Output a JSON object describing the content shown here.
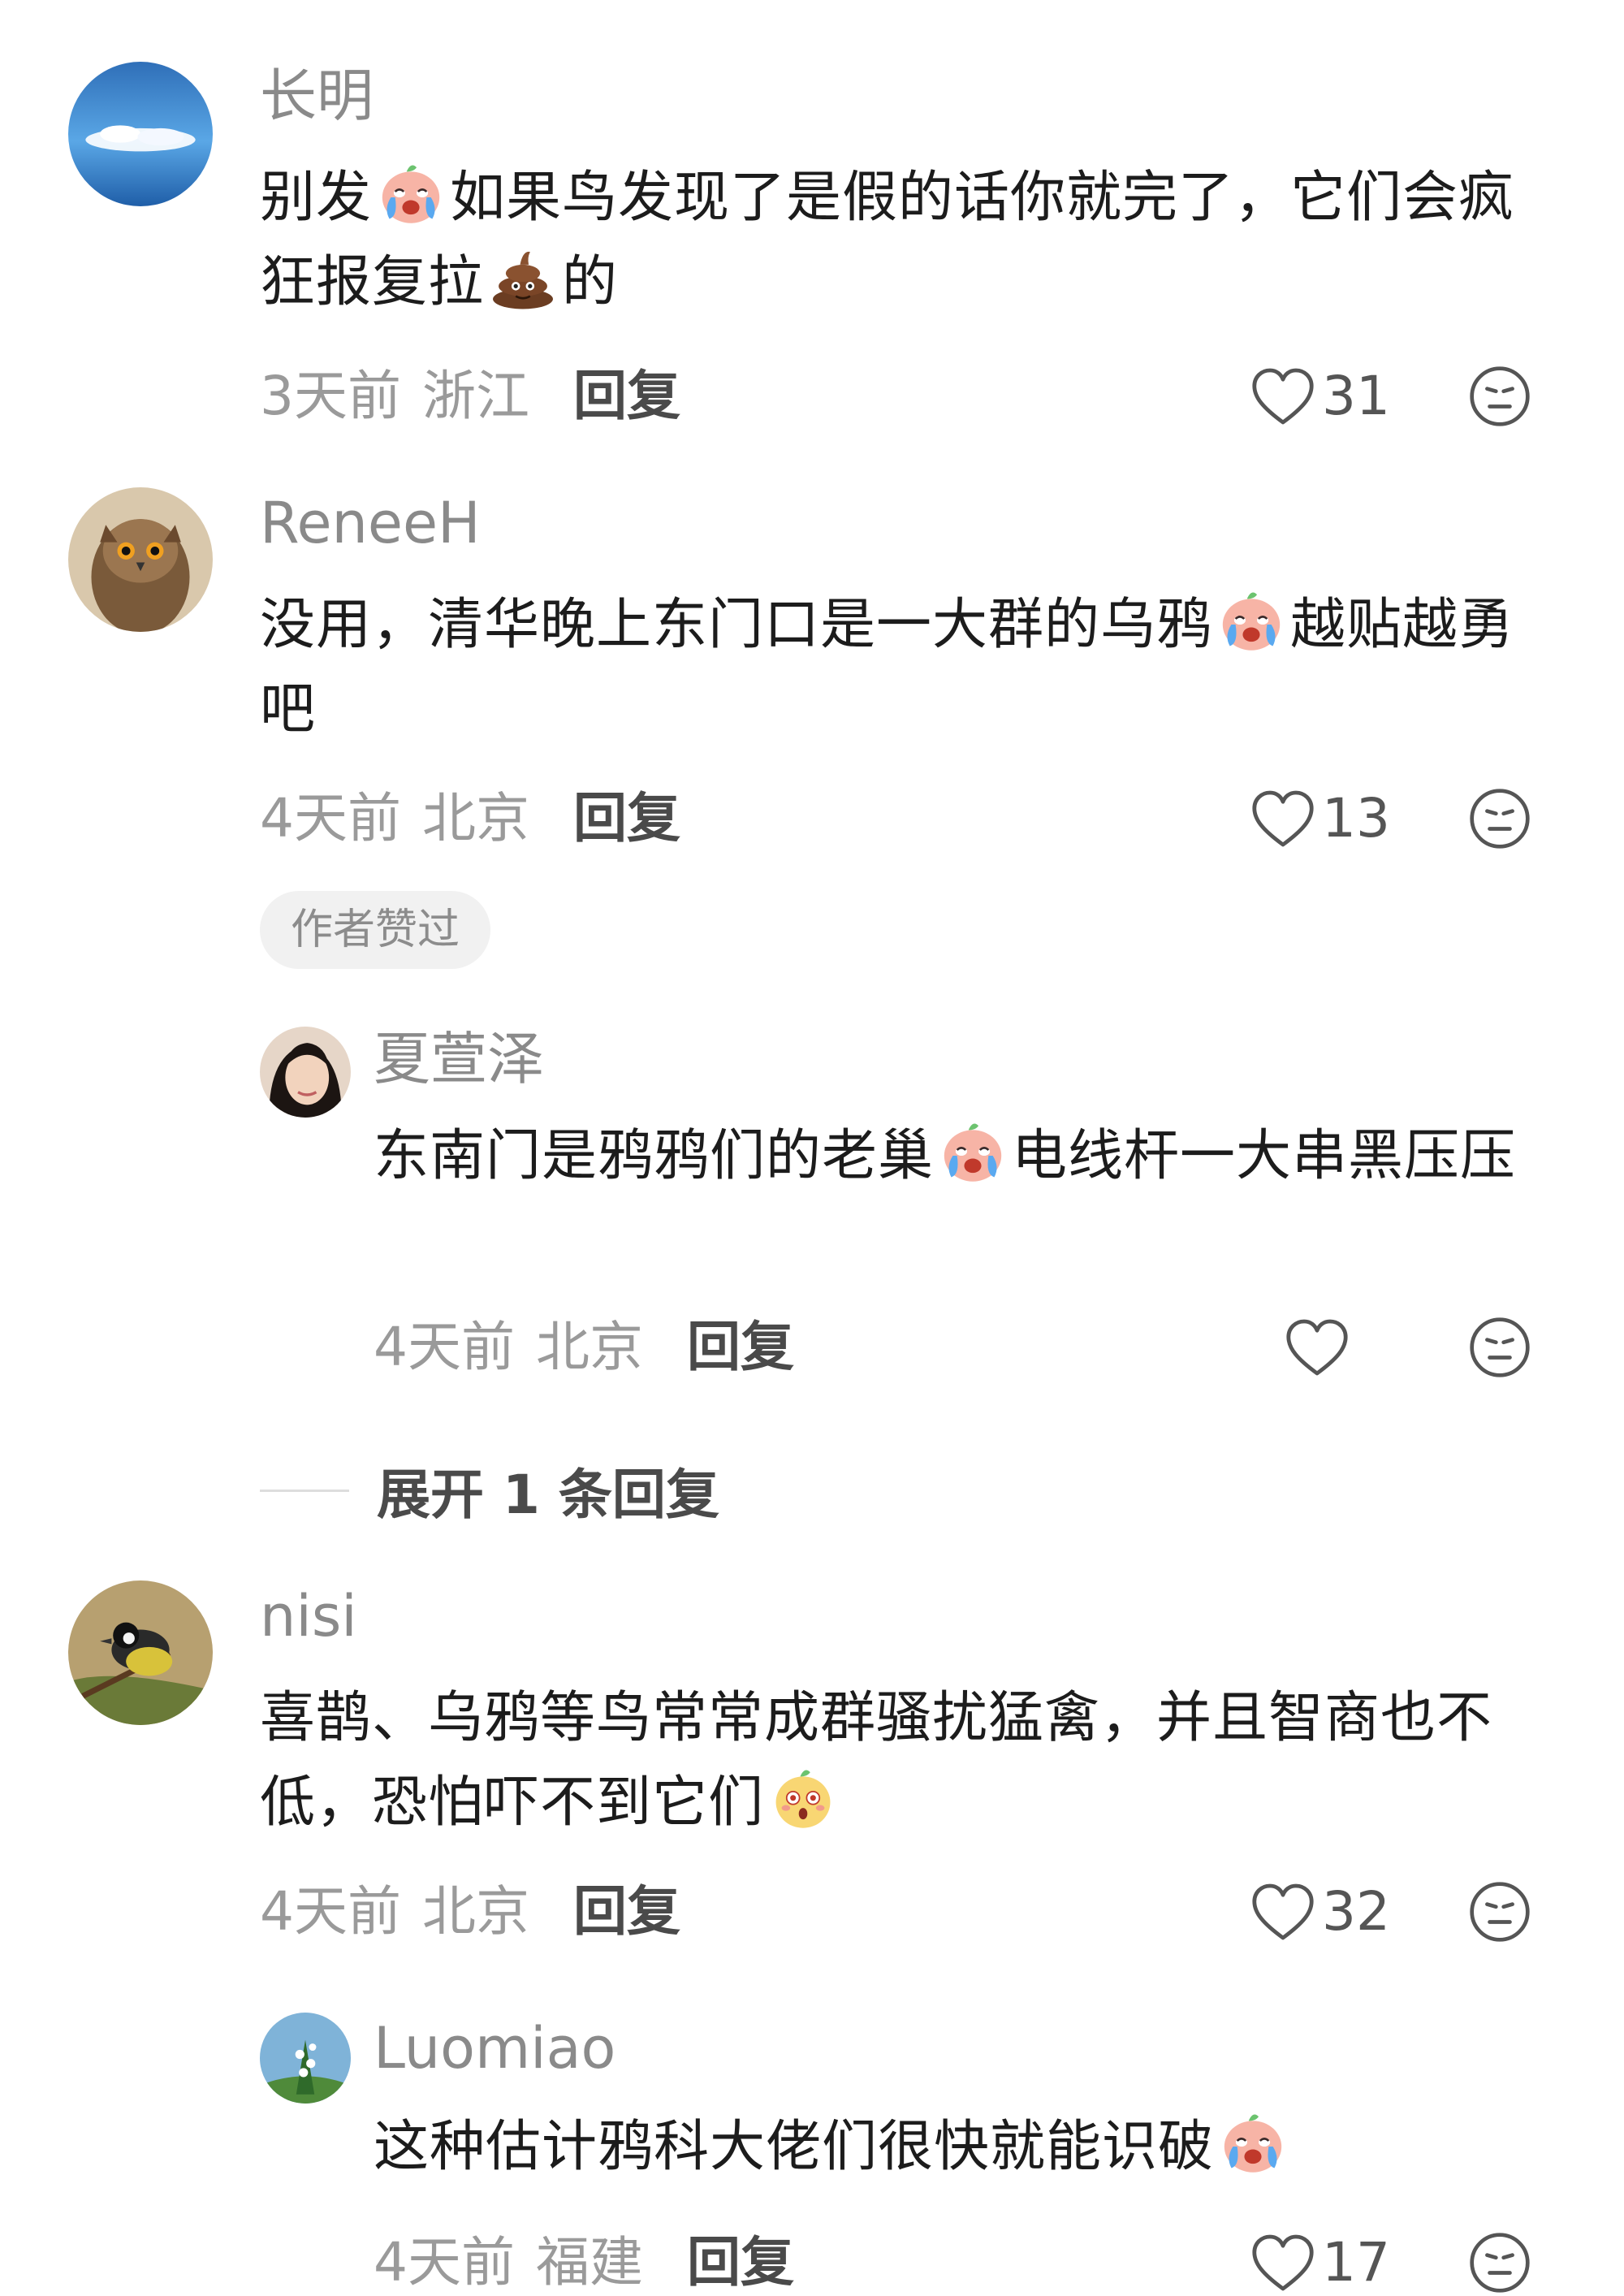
{
  "comments": [
    {
      "username": "长明",
      "text_a": "别发",
      "text_b": "如果鸟发现了是假的话你就完了，它们会疯狂报复拉",
      "text_c": "的",
      "time": "3天前",
      "location": "浙江",
      "reply_label": "回复",
      "likes": "31",
      "emoji_1": "crying-face-emoji",
      "emoji_2": "poop-emoji"
    },
    {
      "username": "ReneeH",
      "text_a": "没用，清华晚上东门口是一大群的乌鸦",
      "text_b": "越贴越勇吧",
      "time": "4天前",
      "location": "北京",
      "reply_label": "回复",
      "likes": "13",
      "author_tag": "作者赞过",
      "emoji_1": "crying-face-emoji"
    },
    {
      "username": "夏萱泽",
      "text_a": "东南门是鸦鸦们的老巢",
      "text_b": "电线杆一大串黑压压",
      "time": "4天前",
      "location": "北京",
      "reply_label": "回复",
      "emoji_1": "crying-face-emoji"
    },
    {
      "expand_label": "展开 1 条回复"
    },
    {
      "username": "nisi",
      "text_a": "喜鹊、乌鸦等鸟常常成群骚扰猛禽，并且智商也不低，恐怕吓不到它们",
      "time": "4天前",
      "location": "北京",
      "reply_label": "回复",
      "likes": "32",
      "emoji_1": "shocked-face-emoji"
    },
    {
      "username": "Luomiao",
      "text_a": "这种估计鸦科大佬们很快就能识破",
      "time": "4天前",
      "location": "福建",
      "reply_label": "回复",
      "likes": "17",
      "emoji_1": "crying-face-emoji"
    }
  ],
  "colors": {
    "username": "#8a8a8a",
    "content": "#1c1c1c",
    "meta": "#9a9a9a",
    "reply": "#4a4a4a"
  }
}
